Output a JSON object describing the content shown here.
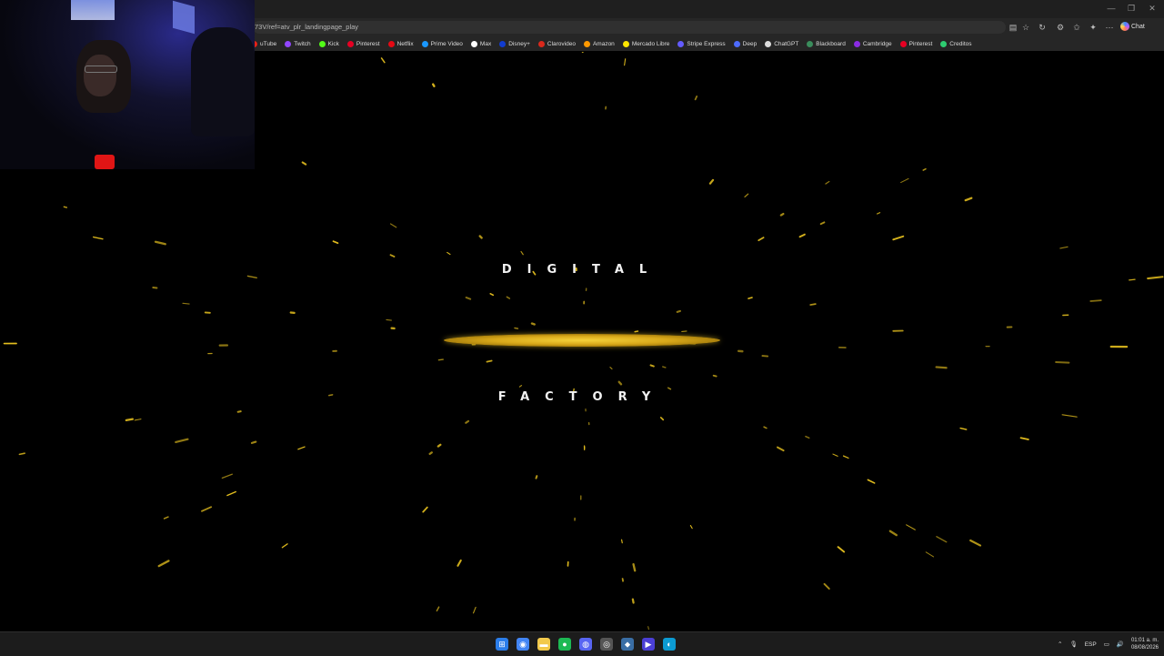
{
  "browser": {
    "url": "73V/ref=atv_plr_landingpage_play",
    "chat_label": "Chat",
    "bookmarks": [
      {
        "label": "uTube",
        "color": "#e62117"
      },
      {
        "label": "Twitch",
        "color": "#9146ff"
      },
      {
        "label": "Kick",
        "color": "#53fc18"
      },
      {
        "label": "Pinterest",
        "color": "#e60023"
      },
      {
        "label": "Netflix",
        "color": "#e50914"
      },
      {
        "label": "Prime Video",
        "color": "#1a98ff"
      },
      {
        "label": "Max",
        "color": "#ffffff"
      },
      {
        "label": "Disney+",
        "color": "#113ccf"
      },
      {
        "label": "Clarovideo",
        "color": "#da291c"
      },
      {
        "label": "Amazon",
        "color": "#ff9900"
      },
      {
        "label": "Mercado Libre",
        "color": "#ffe600"
      },
      {
        "label": "Stripe Express",
        "color": "#635bff"
      },
      {
        "label": "Deep",
        "color": "#4d6bfe"
      },
      {
        "label": "ChatGPT",
        "color": "#dddddd"
      },
      {
        "label": "Blackboard",
        "color": "#3a8d5c"
      },
      {
        "label": "Cambridge",
        "color": "#8a2be2"
      },
      {
        "label": "Pinterest",
        "color": "#e60023"
      },
      {
        "label": "Creditos",
        "color": "#2ecc71"
      }
    ]
  },
  "splash": {
    "line1": "DIGITAL",
    "line2": "FACTORY",
    "accent_color": "#e8c21f"
  },
  "taskbar": {
    "apps": [
      {
        "icon": "windows-start-icon",
        "glyph": "⊞",
        "color": "#2b7de9"
      },
      {
        "icon": "chrome-icon",
        "glyph": "◉",
        "color": "#4285f4"
      },
      {
        "icon": "file-explorer-icon",
        "glyph": "▬",
        "color": "#f2c94c"
      },
      {
        "icon": "spotify-icon",
        "glyph": "●",
        "color": "#1db954"
      },
      {
        "icon": "discord-icon",
        "glyph": "◍",
        "color": "#5865f2"
      },
      {
        "icon": "obs-icon",
        "glyph": "◎",
        "color": "#555555"
      },
      {
        "icon": "vpn-icon",
        "glyph": "⬥",
        "color": "#3a6ea5"
      },
      {
        "icon": "prime-video-icon",
        "glyph": "▶",
        "color": "#4b3fd6"
      },
      {
        "icon": "edge-icon",
        "glyph": "◐",
        "color": "#0c9bd3"
      }
    ],
    "language": "ESP",
    "time": "01:01 a. m.",
    "date": "08/08/2026"
  }
}
